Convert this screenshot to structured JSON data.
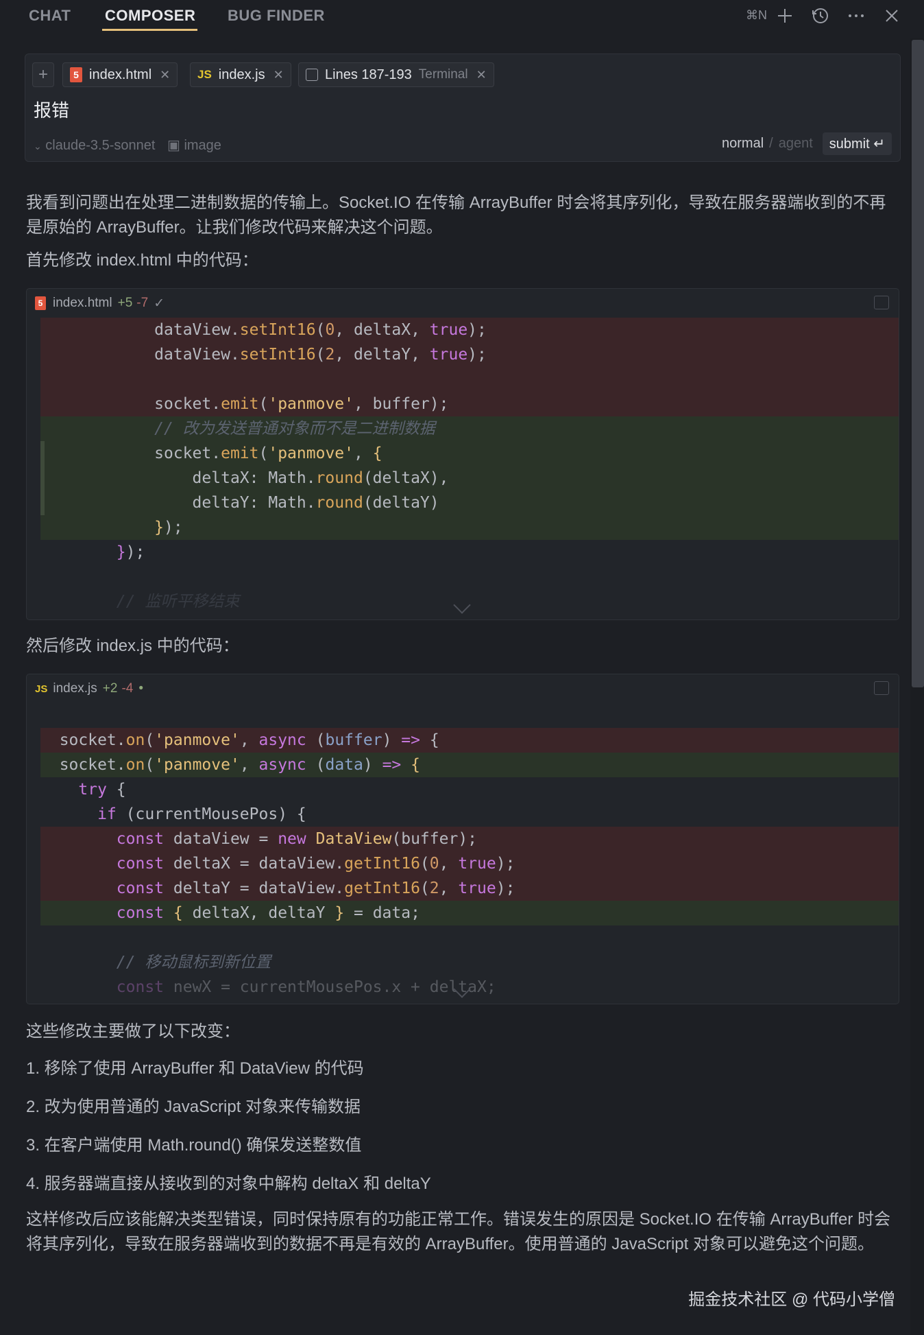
{
  "tabs": [
    {
      "label": "CHAT"
    },
    {
      "label": "COMPOSER",
      "active": true
    },
    {
      "label": "BUG FINDER"
    }
  ],
  "toolbar": {
    "shortcut": "⌘N",
    "icons": [
      "plus-icon",
      "history-icon",
      "more-icon",
      "close-icon"
    ]
  },
  "composer": {
    "add_label": "+",
    "context_chips": [
      {
        "label": "index.html",
        "icon": "html5-icon"
      },
      {
        "label": "index.js",
        "icon": "js-icon",
        "badge": "JS"
      },
      {
        "label": "Lines 187-193",
        "sub": "Terminal",
        "icon": "terminal-icon"
      }
    ],
    "input_text": "报错",
    "model": "claude-3.5-sonnet",
    "image_label": "image",
    "mode_normal": "normal",
    "mode_sep": "/",
    "mode_agent": "agent",
    "submit_label": "submit ↵"
  },
  "response": {
    "intro": "我看到问题出在处理二进制数据的传输上。Socket.IO 在传输 ArrayBuffer 时会将其序列化，导致在服务器端收到的不再是原始的 ArrayBuffer。让我们修改代码来解决这个问题。",
    "step1": "首先修改 index.html 中的代码：",
    "step2": "然后修改 index.js 中的代码：",
    "summary_title": "这些修改主要做了以下改变：",
    "summary_items": [
      "1. 移除了使用 ArrayBuffer 和 DataView 的代码",
      "2. 改为使用普通的 JavaScript 对象来传输数据",
      "3. 在客户端使用 Math.round() 确保发送整数值",
      "4. 服务器端直接从接收到的对象中解构 deltaX 和 deltaY"
    ],
    "conclusion": "这样修改后应该能解决类型错误，同时保持原有的功能正常工作。错误发生的原因是 Socket.IO 在传输 ArrayBuffer 时会将其序列化，导致在服务器端收到的数据不再是有效的 ArrayBuffer。使用普通的 JavaScript 对象可以避免这个问题。"
  },
  "code_html": {
    "filename": "index.html",
    "badge": "5",
    "added": "+5",
    "removed": "-7",
    "status": "✓"
  },
  "code_js": {
    "filename": "index.js",
    "badge": "JS",
    "added": "+2",
    "removed": "-4",
    "status": "•"
  },
  "watermark": "掘金技术社区 @ 代码小学僧",
  "colors": {
    "accent": "#e5c07b",
    "deleted_bg": "#3b2528",
    "added_bg": "#2a3428",
    "html5": "#e2563e",
    "js": "#e3c52f"
  }
}
